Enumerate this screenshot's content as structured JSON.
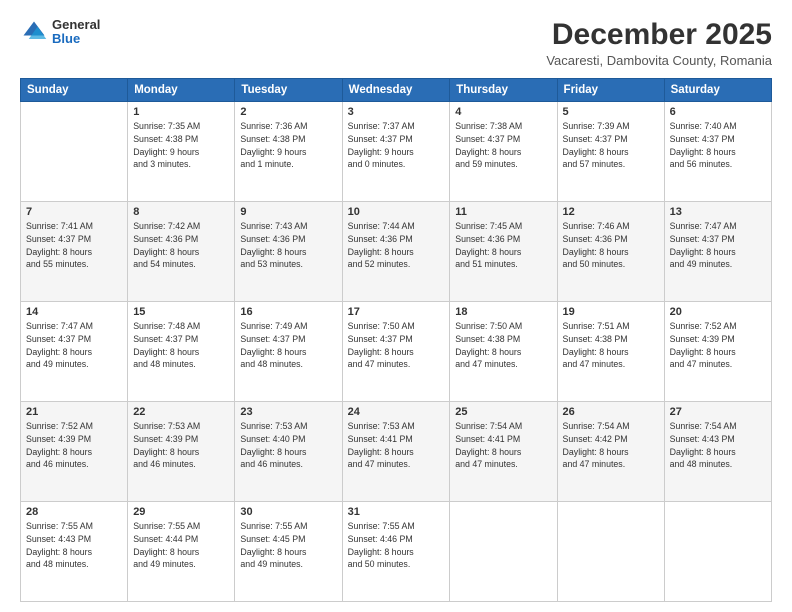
{
  "header": {
    "logo_general": "General",
    "logo_blue": "Blue",
    "month_title": "December 2025",
    "location": "Vacaresti, Dambovita County, Romania"
  },
  "weekdays": [
    "Sunday",
    "Monday",
    "Tuesday",
    "Wednesday",
    "Thursday",
    "Friday",
    "Saturday"
  ],
  "weeks": [
    [
      {
        "day": "",
        "info": ""
      },
      {
        "day": "1",
        "info": "Sunrise: 7:35 AM\nSunset: 4:38 PM\nDaylight: 9 hours\nand 3 minutes."
      },
      {
        "day": "2",
        "info": "Sunrise: 7:36 AM\nSunset: 4:38 PM\nDaylight: 9 hours\nand 1 minute."
      },
      {
        "day": "3",
        "info": "Sunrise: 7:37 AM\nSunset: 4:37 PM\nDaylight: 9 hours\nand 0 minutes."
      },
      {
        "day": "4",
        "info": "Sunrise: 7:38 AM\nSunset: 4:37 PM\nDaylight: 8 hours\nand 59 minutes."
      },
      {
        "day": "5",
        "info": "Sunrise: 7:39 AM\nSunset: 4:37 PM\nDaylight: 8 hours\nand 57 minutes."
      },
      {
        "day": "6",
        "info": "Sunrise: 7:40 AM\nSunset: 4:37 PM\nDaylight: 8 hours\nand 56 minutes."
      }
    ],
    [
      {
        "day": "7",
        "info": "Sunrise: 7:41 AM\nSunset: 4:37 PM\nDaylight: 8 hours\nand 55 minutes."
      },
      {
        "day": "8",
        "info": "Sunrise: 7:42 AM\nSunset: 4:36 PM\nDaylight: 8 hours\nand 54 minutes."
      },
      {
        "day": "9",
        "info": "Sunrise: 7:43 AM\nSunset: 4:36 PM\nDaylight: 8 hours\nand 53 minutes."
      },
      {
        "day": "10",
        "info": "Sunrise: 7:44 AM\nSunset: 4:36 PM\nDaylight: 8 hours\nand 52 minutes."
      },
      {
        "day": "11",
        "info": "Sunrise: 7:45 AM\nSunset: 4:36 PM\nDaylight: 8 hours\nand 51 minutes."
      },
      {
        "day": "12",
        "info": "Sunrise: 7:46 AM\nSunset: 4:36 PM\nDaylight: 8 hours\nand 50 minutes."
      },
      {
        "day": "13",
        "info": "Sunrise: 7:47 AM\nSunset: 4:37 PM\nDaylight: 8 hours\nand 49 minutes."
      }
    ],
    [
      {
        "day": "14",
        "info": "Sunrise: 7:47 AM\nSunset: 4:37 PM\nDaylight: 8 hours\nand 49 minutes."
      },
      {
        "day": "15",
        "info": "Sunrise: 7:48 AM\nSunset: 4:37 PM\nDaylight: 8 hours\nand 48 minutes."
      },
      {
        "day": "16",
        "info": "Sunrise: 7:49 AM\nSunset: 4:37 PM\nDaylight: 8 hours\nand 48 minutes."
      },
      {
        "day": "17",
        "info": "Sunrise: 7:50 AM\nSunset: 4:37 PM\nDaylight: 8 hours\nand 47 minutes."
      },
      {
        "day": "18",
        "info": "Sunrise: 7:50 AM\nSunset: 4:38 PM\nDaylight: 8 hours\nand 47 minutes."
      },
      {
        "day": "19",
        "info": "Sunrise: 7:51 AM\nSunset: 4:38 PM\nDaylight: 8 hours\nand 47 minutes."
      },
      {
        "day": "20",
        "info": "Sunrise: 7:52 AM\nSunset: 4:39 PM\nDaylight: 8 hours\nand 47 minutes."
      }
    ],
    [
      {
        "day": "21",
        "info": "Sunrise: 7:52 AM\nSunset: 4:39 PM\nDaylight: 8 hours\nand 46 minutes."
      },
      {
        "day": "22",
        "info": "Sunrise: 7:53 AM\nSunset: 4:39 PM\nDaylight: 8 hours\nand 46 minutes."
      },
      {
        "day": "23",
        "info": "Sunrise: 7:53 AM\nSunset: 4:40 PM\nDaylight: 8 hours\nand 46 minutes."
      },
      {
        "day": "24",
        "info": "Sunrise: 7:53 AM\nSunset: 4:41 PM\nDaylight: 8 hours\nand 47 minutes."
      },
      {
        "day": "25",
        "info": "Sunrise: 7:54 AM\nSunset: 4:41 PM\nDaylight: 8 hours\nand 47 minutes."
      },
      {
        "day": "26",
        "info": "Sunrise: 7:54 AM\nSunset: 4:42 PM\nDaylight: 8 hours\nand 47 minutes."
      },
      {
        "day": "27",
        "info": "Sunrise: 7:54 AM\nSunset: 4:43 PM\nDaylight: 8 hours\nand 48 minutes."
      }
    ],
    [
      {
        "day": "28",
        "info": "Sunrise: 7:55 AM\nSunset: 4:43 PM\nDaylight: 8 hours\nand 48 minutes."
      },
      {
        "day": "29",
        "info": "Sunrise: 7:55 AM\nSunset: 4:44 PM\nDaylight: 8 hours\nand 49 minutes."
      },
      {
        "day": "30",
        "info": "Sunrise: 7:55 AM\nSunset: 4:45 PM\nDaylight: 8 hours\nand 49 minutes."
      },
      {
        "day": "31",
        "info": "Sunrise: 7:55 AM\nSunset: 4:46 PM\nDaylight: 8 hours\nand 50 minutes."
      },
      {
        "day": "",
        "info": ""
      },
      {
        "day": "",
        "info": ""
      },
      {
        "day": "",
        "info": ""
      }
    ]
  ]
}
